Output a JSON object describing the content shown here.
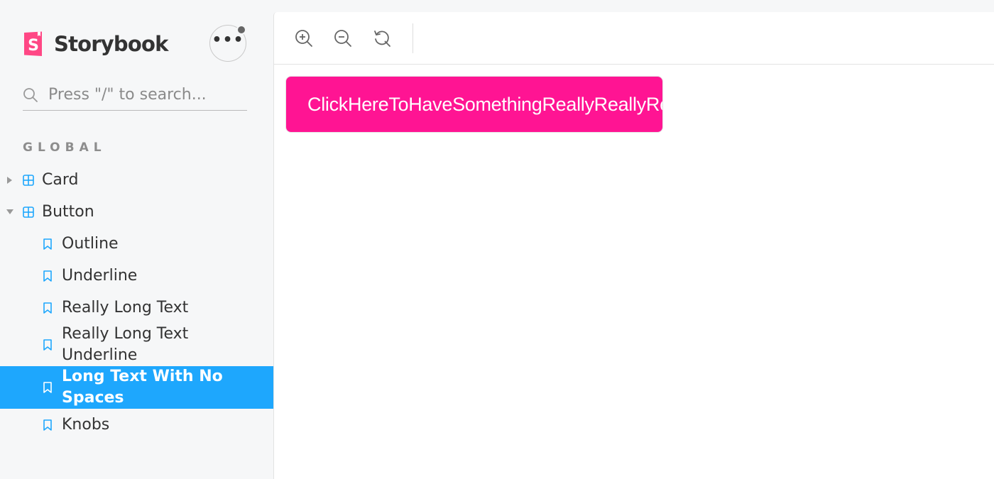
{
  "brand": {
    "name": "Storybook",
    "logo_icon": "storybook-logo-icon",
    "accent": "#ff4785"
  },
  "menu": {
    "icon": "ellipsis-icon",
    "label": "•••",
    "has_notification": true
  },
  "search": {
    "placeholder": "Press \"/\" to search...",
    "icon": "search-icon"
  },
  "section_title": "GLOBAL",
  "tree": {
    "components": [
      {
        "label": "Card",
        "expanded": false,
        "icon": "component-icon"
      },
      {
        "label": "Button",
        "expanded": true,
        "icon": "component-icon",
        "stories": [
          {
            "label": "Outline",
            "icon": "bookmark-icon"
          },
          {
            "label": "Underline",
            "icon": "bookmark-icon"
          },
          {
            "label": "Really Long Text",
            "icon": "bookmark-icon"
          },
          {
            "label": "Really Long Text Underline",
            "icon": "bookmark-icon"
          },
          {
            "label": "Long Text With No Spaces",
            "icon": "bookmark-icon",
            "selected": true
          },
          {
            "label": "Knobs",
            "icon": "bookmark-icon"
          }
        ]
      }
    ]
  },
  "toolbar": {
    "buttons": [
      "zoom-in-icon",
      "zoom-out-icon",
      "reset-zoom-icon"
    ]
  },
  "preview": {
    "button_text": "ClickHereToHaveSomethingReallyReallyReallyReallyLongWithNoSpaces",
    "button_color": "#ff1493"
  },
  "colors": {
    "selection": "#1ea7fd",
    "icon_blue": "#1ea7fd"
  }
}
